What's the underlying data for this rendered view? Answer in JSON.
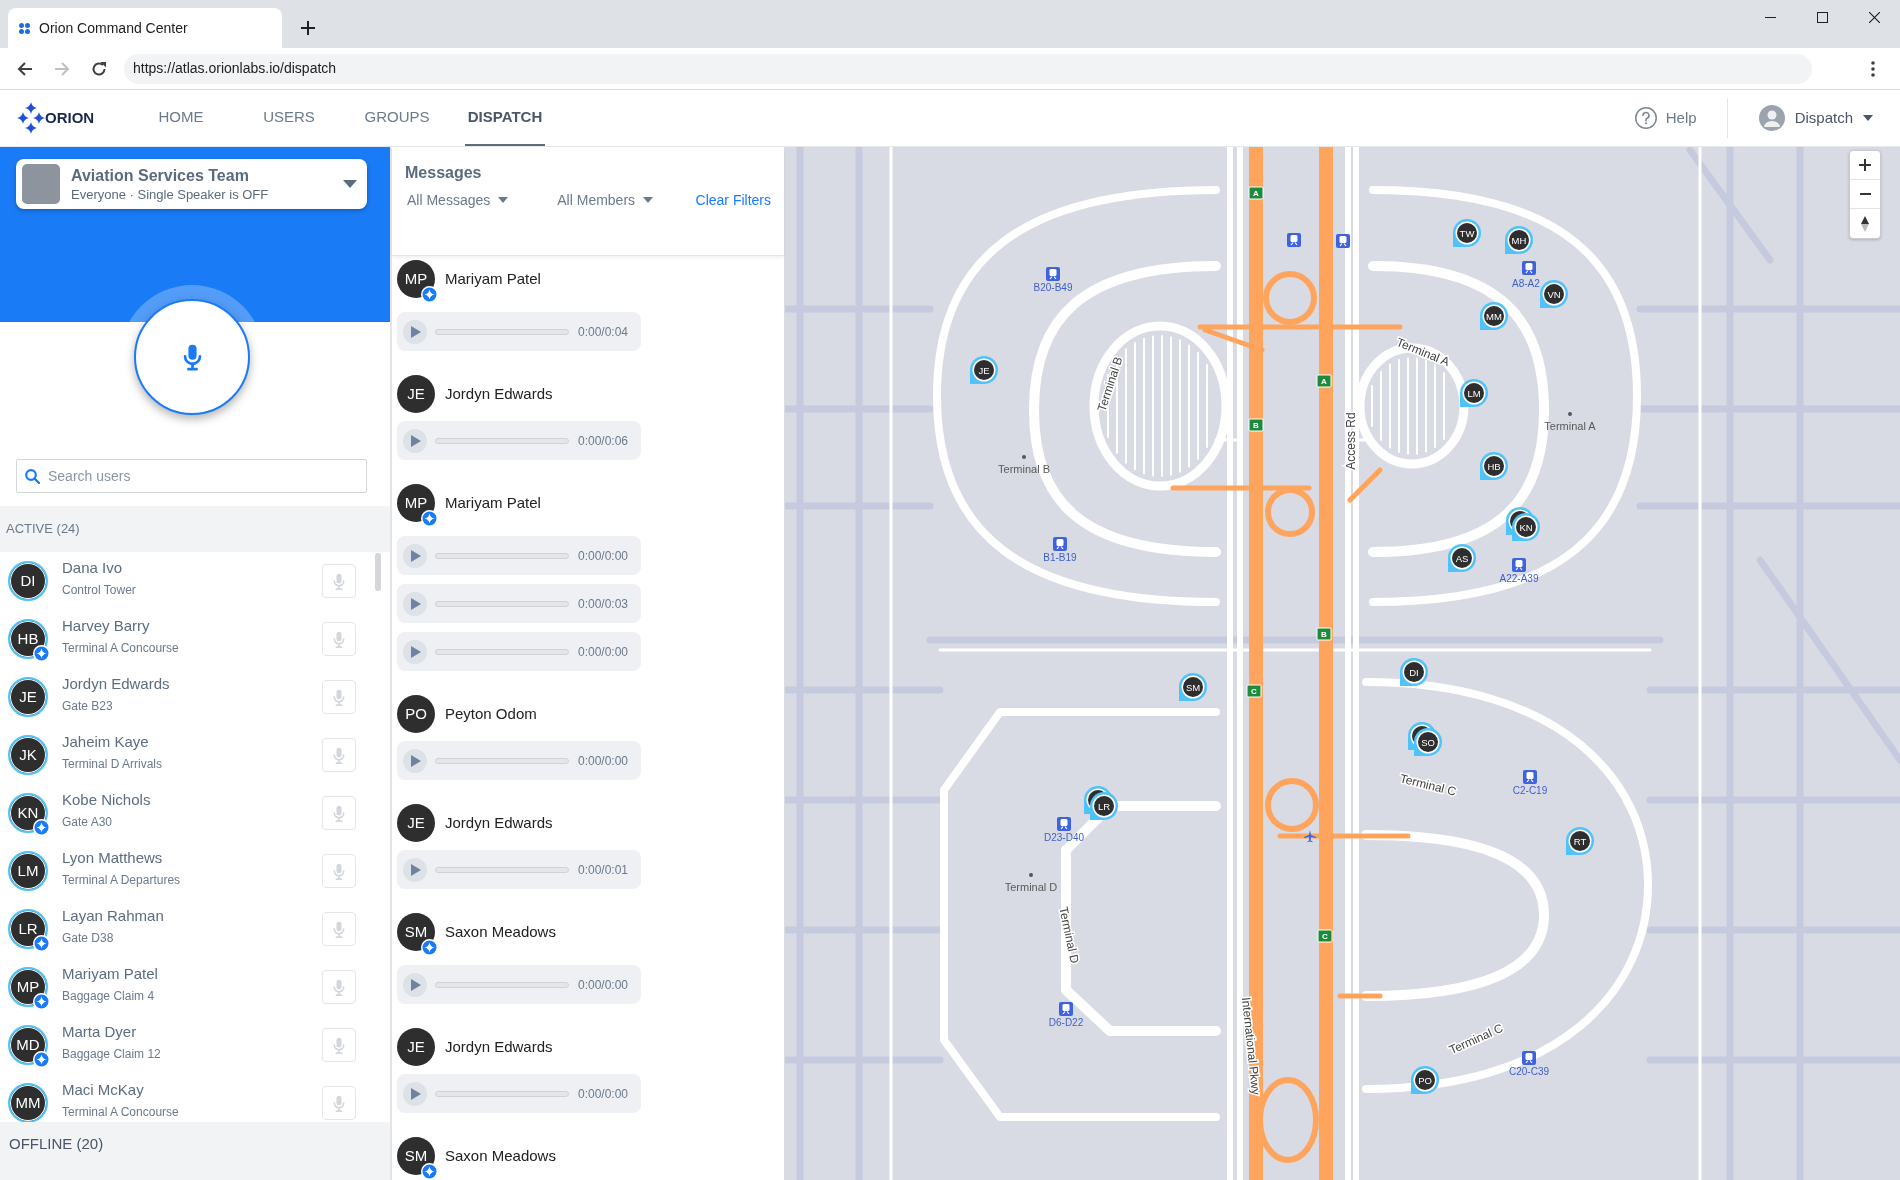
{
  "browser": {
    "tab_title": "Orion Command Center",
    "url": "https://atlas.orionlabs.io/dispatch"
  },
  "header": {
    "logo": "ORION",
    "nav": [
      {
        "label": "HOME",
        "selected": false
      },
      {
        "label": "USERS",
        "selected": false
      },
      {
        "label": "GROUPS",
        "selected": false
      },
      {
        "label": "DISPATCH",
        "selected": true
      }
    ],
    "help": "Help",
    "account": "Dispatch"
  },
  "group": {
    "name": "Aviation Services Team",
    "subtitle": "Everyone · Single Speaker is OFF"
  },
  "search": {
    "placeholder": "Search users"
  },
  "active_users": {
    "title": "ACTIVE (24)",
    "users": [
      {
        "initials": "DI",
        "name": "Dana Ivo",
        "location": "Control Tower",
        "orion_badge": false
      },
      {
        "initials": "HB",
        "name": "Harvey Barry",
        "location": "Terminal A Concourse",
        "orion_badge": true
      },
      {
        "initials": "JE",
        "name": "Jordyn Edwards",
        "location": "Gate B23",
        "orion_badge": false
      },
      {
        "initials": "JK",
        "name": "Jaheim Kaye",
        "location": "Terminal D Arrivals",
        "orion_badge": false
      },
      {
        "initials": "KN",
        "name": "Kobe Nichols",
        "location": "Gate A30",
        "orion_badge": true
      },
      {
        "initials": "LM",
        "name": "Lyon Matthews",
        "location": "Terminal A Departures",
        "orion_badge": false
      },
      {
        "initials": "LR",
        "name": "Layan Rahman",
        "location": "Gate D38",
        "orion_badge": true
      },
      {
        "initials": "MP",
        "name": "Mariyam Patel",
        "location": "Baggage Claim 4",
        "orion_badge": true
      },
      {
        "initials": "MD",
        "name": "Marta Dyer",
        "location": "Baggage Claim 12",
        "orion_badge": true
      },
      {
        "initials": "MM",
        "name": "Maci McKay",
        "location": "Terminal A Concourse",
        "orion_badge": false
      }
    ]
  },
  "offline_users": {
    "title": "OFFLINE (20)"
  },
  "messages": {
    "title": "Messages",
    "filters": [
      {
        "label": "All Messages"
      },
      {
        "label": "All Members"
      }
    ],
    "clear_filters": "Clear Filters",
    "items": [
      {
        "initials": "MP",
        "name": "Mariyam Patel",
        "orion_badge": true,
        "clips": [
          "0:00/0:04"
        ]
      },
      {
        "initials": "JE",
        "name": "Jordyn Edwards",
        "orion_badge": false,
        "clips": [
          "0:00/0:06"
        ]
      },
      {
        "initials": "MP",
        "name": "Mariyam Patel",
        "orion_badge": true,
        "clips": [
          "0:00/0:00",
          "0:00/0:03",
          "0:00/0:00"
        ]
      },
      {
        "initials": "PO",
        "name": "Peyton Odom",
        "orion_badge": false,
        "clips": [
          "0:00/0:00"
        ]
      },
      {
        "initials": "JE",
        "name": "Jordyn Edwards",
        "orion_badge": false,
        "clips": [
          "0:00/0:01"
        ]
      },
      {
        "initials": "SM",
        "name": "Saxon Meadows",
        "orion_badge": true,
        "clips": [
          "0:00/0:00"
        ]
      },
      {
        "initials": "JE",
        "name": "Jordyn Edwards",
        "orion_badge": false,
        "clips": [
          "0:00/0:00"
        ]
      },
      {
        "initials": "SM",
        "name": "Saxon Meadows",
        "orion_badge": true
      }
    ]
  },
  "map": {
    "route_shields": [
      "A",
      "A",
      "B",
      "B",
      "C",
      "C"
    ],
    "stations": [
      {
        "kind": "labeled",
        "label": "B20-B49"
      },
      {
        "kind": "icon_only"
      },
      {
        "kind": "icon_only"
      },
      {
        "kind": "labeled",
        "label": "A8-A2"
      },
      {
        "kind": "labeled",
        "label": "B1-B19"
      },
      {
        "kind": "labeled",
        "label": "A22-A39"
      },
      {
        "kind": "labeled",
        "label": "C2-C19"
      },
      {
        "kind": "labeled",
        "label": "D23-D40"
      },
      {
        "kind": "labeled",
        "label": "D6-D22"
      },
      {
        "kind": "labeled",
        "label": "C20-C39"
      }
    ],
    "place_labels": [
      "Terminal B",
      "Terminal A",
      "Terminal D"
    ],
    "road_labels": [
      "Terminal B",
      "Terminal A",
      "Access Rd",
      "Terminal C",
      "Terminal D",
      "International Pkwy",
      "Terminal C"
    ],
    "pins": [
      {
        "initials": "TW",
        "stacked": false
      },
      {
        "initials": "MH",
        "stacked": false
      },
      {
        "initials": "VN",
        "stacked": false
      },
      {
        "initials": "MM",
        "stacked": false
      },
      {
        "initials": "JE",
        "stacked": false
      },
      {
        "initials": "LM",
        "stacked": false
      },
      {
        "initials": "HB",
        "stacked": false
      },
      {
        "initials": "KN",
        "stacked": true
      },
      {
        "initials": "AS",
        "stacked": false
      },
      {
        "initials": "DI",
        "stacked": false
      },
      {
        "initials": "SM",
        "stacked": false
      },
      {
        "initials": "SO",
        "stacked": true
      },
      {
        "initials": "LR",
        "stacked": true
      },
      {
        "initials": "RT",
        "stacked": false
      },
      {
        "initials": "PO",
        "stacked": false
      }
    ]
  }
}
